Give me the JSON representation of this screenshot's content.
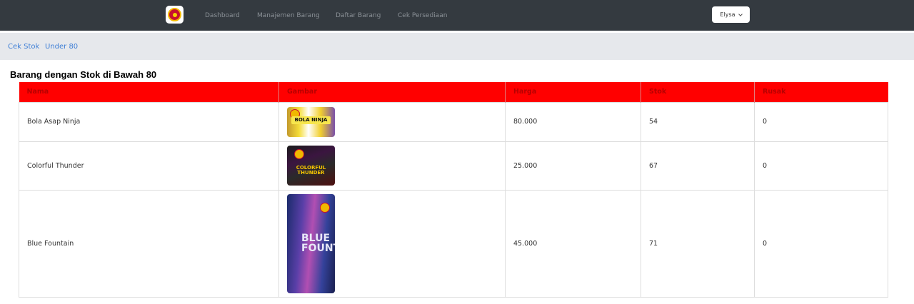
{
  "nav": {
    "items": [
      {
        "label": "Dashboard"
      },
      {
        "label": "Manajemen Barang"
      },
      {
        "label": "Daftar Barang"
      },
      {
        "label": "Cek Persediaan"
      }
    ],
    "user": "Elysa"
  },
  "breadcrumb": [
    "Cek Stok",
    "Under 80"
  ],
  "page_title": "Barang dengan Stok di Bawah 80",
  "table": {
    "headers": [
      "Nama",
      "Gambar",
      "Harga",
      "Stok",
      "Rusak"
    ],
    "rows": [
      {
        "nama": "Bola Asap Ninja",
        "image_text": "BOLA NINJA",
        "harga": "80.000",
        "stok": "54",
        "rusak": "0"
      },
      {
        "nama": "Colorful Thunder",
        "image_text": "COLORFUL THUNDER",
        "harga": "25.000",
        "stok": "67",
        "rusak": "0"
      },
      {
        "nama": "Blue Fountain",
        "image_text": "BLUE FOUNTA",
        "harga": "45.000",
        "stok": "71",
        "rusak": "0"
      }
    ]
  },
  "colors": {
    "topbar": "#343a40",
    "header_red": "#ff0000",
    "link_blue": "#3f7fd6",
    "breadcrumb_bg": "#e6e8ec"
  }
}
